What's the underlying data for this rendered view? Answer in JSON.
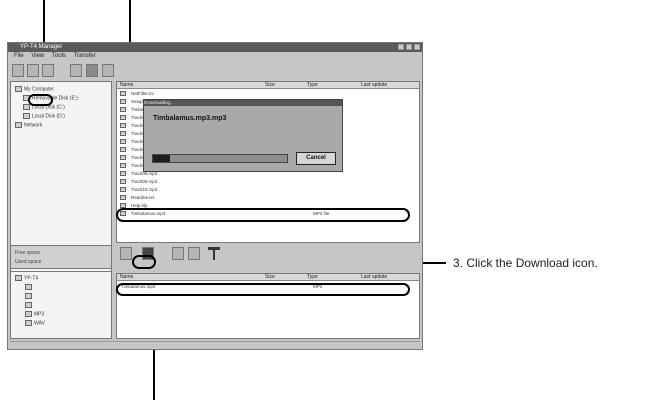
{
  "caption": "3. Click the Download icon.",
  "window": {
    "title": "YP-T4 Manager",
    "menu": [
      "File",
      "View",
      "Tools",
      "Transfer"
    ]
  },
  "toolbar_icons": [
    "new-folder-icon",
    "delete-icon",
    "properties-icon",
    "upload-icon",
    "device-icon",
    "info-icon"
  ],
  "pc_tree": {
    "items": [
      {
        "label": "My Computer",
        "icon": "computer-icon"
      },
      {
        "label": "Removable Disk (E:)",
        "icon": "drive-icon"
      },
      {
        "label": "Local Disk (C:)",
        "icon": "drive-icon"
      },
      {
        "label": "Local Disk (D:)",
        "icon": "drive-icon"
      },
      {
        "label": "Network",
        "icon": "network-icon"
      }
    ]
  },
  "pc_files": {
    "columns": [
      "Name",
      "Size",
      "Type",
      "Last update"
    ],
    "rows": [
      {
        "name": "NetFilter.ini",
        "size": "",
        "type": "",
        "date": ""
      },
      {
        "name": "Setup.exe",
        "size": "",
        "type": "",
        "date": ""
      },
      {
        "name": "Timbala.mp3",
        "size": "",
        "type": "",
        "date": ""
      },
      {
        "name": "Track01.mp3",
        "size": "",
        "type": "",
        "date": ""
      },
      {
        "name": "Track02.mp3",
        "size": "",
        "type": "",
        "date": ""
      },
      {
        "name": "Track03.mp3",
        "size": "",
        "type": "",
        "date": ""
      },
      {
        "name": "Track04.mp3",
        "size": "",
        "type": "",
        "date": ""
      },
      {
        "name": "Track05.mp3",
        "size": "",
        "type": "",
        "date": ""
      },
      {
        "name": "Track06.mp3",
        "size": "",
        "type": "",
        "date": ""
      },
      {
        "name": "Track07.mp3",
        "size": "",
        "type": "",
        "date": ""
      },
      {
        "name": "Track08.mp3",
        "size": "",
        "type": "",
        "date": ""
      },
      {
        "name": "Track09.mp3",
        "size": "",
        "type": "",
        "date": ""
      },
      {
        "name": "Track10.mp3",
        "size": "",
        "type": "",
        "date": ""
      },
      {
        "name": "Readme.txt",
        "size": "",
        "type": "",
        "date": ""
      },
      {
        "name": "Help.hlp",
        "size": "",
        "type": "",
        "date": ""
      },
      {
        "name": "Timbalamus.mp3",
        "size": "",
        "type": "MP3 file",
        "date": ""
      }
    ]
  },
  "dialog": {
    "title": "Downloading...",
    "file": "Timbalamus.mp3.mp3",
    "cancel_label": "Cancel",
    "progress": 0.13
  },
  "device_info": {
    "free": "Free space",
    "used": "Used space"
  },
  "device_tree": {
    "root": "YP-T4",
    "folders": [
      "",
      "",
      "",
      "MP3",
      "WAV"
    ]
  },
  "device_toolbar_icons": [
    "copy-icon",
    "download-icon",
    "delete-icon",
    "rename-icon",
    "format-icon"
  ],
  "device_files": {
    "columns": [
      "Name",
      "Size",
      "Type",
      "Last update"
    ],
    "rows": [
      {
        "name": "Timbalamus.mp3",
        "size": "",
        "type": "MP3",
        "date": ""
      }
    ]
  },
  "statusbar": {
    "left": "",
    "right": ""
  },
  "colors": {
    "titlebar": "#5a5a5a",
    "window": "#c6c6c6",
    "highlight": "#000000"
  }
}
